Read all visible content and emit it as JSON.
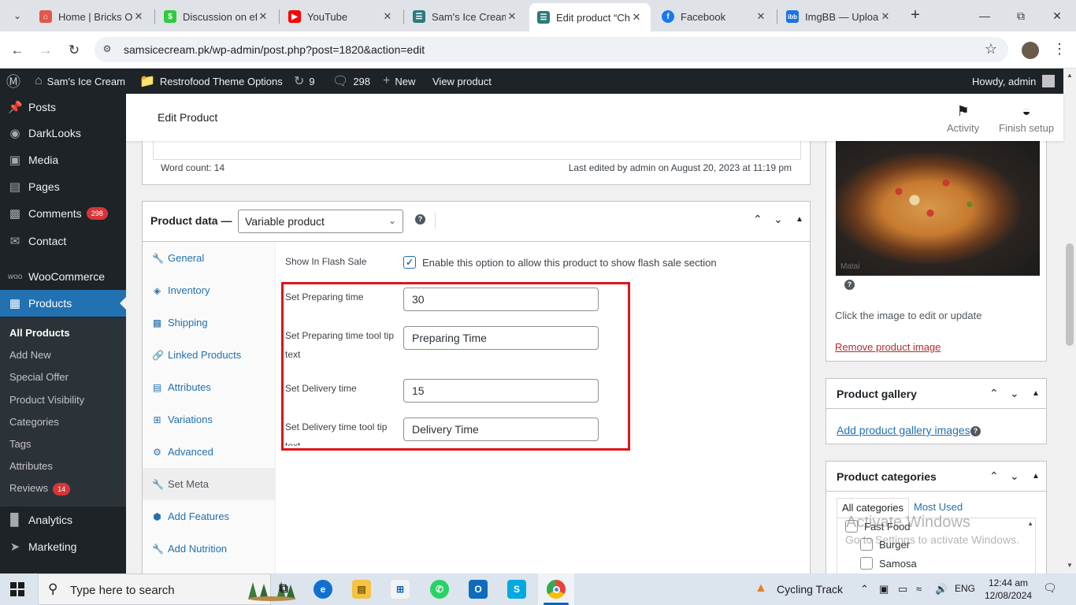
{
  "browser": {
    "tabs": [
      {
        "title": "Home | Bricks Ov",
        "favicon_color": "#e2574c",
        "active": false
      },
      {
        "title": "Discussion on ef",
        "favicon_color": "#2ecc40",
        "active": false
      },
      {
        "title": "YouTube",
        "favicon_color": "#ff0000",
        "active": false
      },
      {
        "title": "Sam's Ice Cream",
        "favicon_color": "#2c7a7b",
        "active": false
      },
      {
        "title": "Edit product “Ch",
        "favicon_color": "#2c7a7b",
        "active": true
      },
      {
        "title": "Facebook",
        "favicon_color": "#1877f2",
        "active": false
      },
      {
        "title": "ImgBB — Uploa",
        "favicon_color": "#1a73e8",
        "active": false
      }
    ],
    "imgbb_favicon_text": "ibb",
    "url": "samsicecream.pk/wp-admin/post.php?post=1820&action=edit"
  },
  "adminbar": {
    "site_name": "Sam's Ice Cream",
    "theme_options": "Restrofood Theme Options",
    "updates_count": "9",
    "comments_count": "298",
    "new_label": "New",
    "view_product": "View product",
    "howdy": "Howdy, admin"
  },
  "sidebar": {
    "items": [
      {
        "label": "Posts",
        "icon": "pin-icon"
      },
      {
        "label": "DarkLooks",
        "icon": "palette-icon"
      },
      {
        "label": "Media",
        "icon": "media-icon"
      },
      {
        "label": "Pages",
        "icon": "page-icon"
      },
      {
        "label": "Comments",
        "icon": "comment-icon",
        "badge": "298"
      },
      {
        "label": "Contact",
        "icon": "mail-icon"
      },
      {
        "label": "WooCommerce",
        "icon": "woo-icon"
      },
      {
        "label": "Products",
        "icon": "archive-icon",
        "current": true
      },
      {
        "label": "Analytics",
        "icon": "chart-icon"
      },
      {
        "label": "Marketing",
        "icon": "megaphone-icon"
      }
    ],
    "submenu": [
      {
        "label": "All Products",
        "current": true
      },
      {
        "label": "Add New"
      },
      {
        "label": "Special Offer"
      },
      {
        "label": "Product Visibility"
      },
      {
        "label": "Categories"
      },
      {
        "label": "Tags"
      },
      {
        "label": "Attributes"
      },
      {
        "label": "Reviews",
        "badge": "14"
      }
    ]
  },
  "wc_header": {
    "title": "Edit Product",
    "activity": "Activity",
    "finish_setup": "Finish setup"
  },
  "editor": {
    "word_count": "Word count: 14",
    "last_edited": "Last edited by admin on August 20, 2023 at 11:19 pm"
  },
  "product_data": {
    "label": "Product data —",
    "type": "Variable product",
    "tabs": [
      {
        "label": "General",
        "icon": "wrench-icon"
      },
      {
        "label": "Inventory",
        "icon": "tag-icon"
      },
      {
        "label": "Shipping",
        "icon": "truck-icon"
      },
      {
        "label": "Linked Products",
        "icon": "link-icon"
      },
      {
        "label": "Attributes",
        "icon": "list-icon"
      },
      {
        "label": "Variations",
        "icon": "grid-icon"
      },
      {
        "label": "Advanced",
        "icon": "gear-icon"
      },
      {
        "label": "Set Meta",
        "icon": "wrench-icon",
        "active": true
      },
      {
        "label": "Add Features",
        "icon": "cube-icon"
      },
      {
        "label": "Add Nutrition",
        "icon": "wrench-icon"
      }
    ],
    "flash_sale_label": "Show In Flash Sale",
    "flash_sale_desc": "Enable this option to allow this product to show flash sale section",
    "flash_sale_checked": true,
    "highlight_color": "#e0121a",
    "fields": [
      {
        "label": "Set Preparing time",
        "value": "30"
      },
      {
        "label": "Set Preparing time tool tip text",
        "value": "Preparing Time"
      },
      {
        "label": "Set Delivery time",
        "value": "15"
      },
      {
        "label": "Set Delivery time tool tip text",
        "value": "Delivery Time"
      }
    ]
  },
  "product_image": {
    "image_text": "Matai",
    "note": "Click the image to edit or update",
    "remove": "Remove product image"
  },
  "gallery": {
    "title": "Product gallery",
    "add_link": "Add product gallery images"
  },
  "categories": {
    "title": "Product categories",
    "tab_all": "All categories",
    "tab_most_used": "Most Used",
    "items": [
      "Fast Food",
      "Burger",
      "Samosa"
    ]
  },
  "watermark": {
    "line1": "Activate Windows",
    "line2": "Go to Settings to activate Windows."
  },
  "taskbar": {
    "search_placeholder": "Type here to search",
    "weather": "Cycling Track",
    "lang": "ENG",
    "time": "12:44 am",
    "date": "12/08/2024"
  }
}
